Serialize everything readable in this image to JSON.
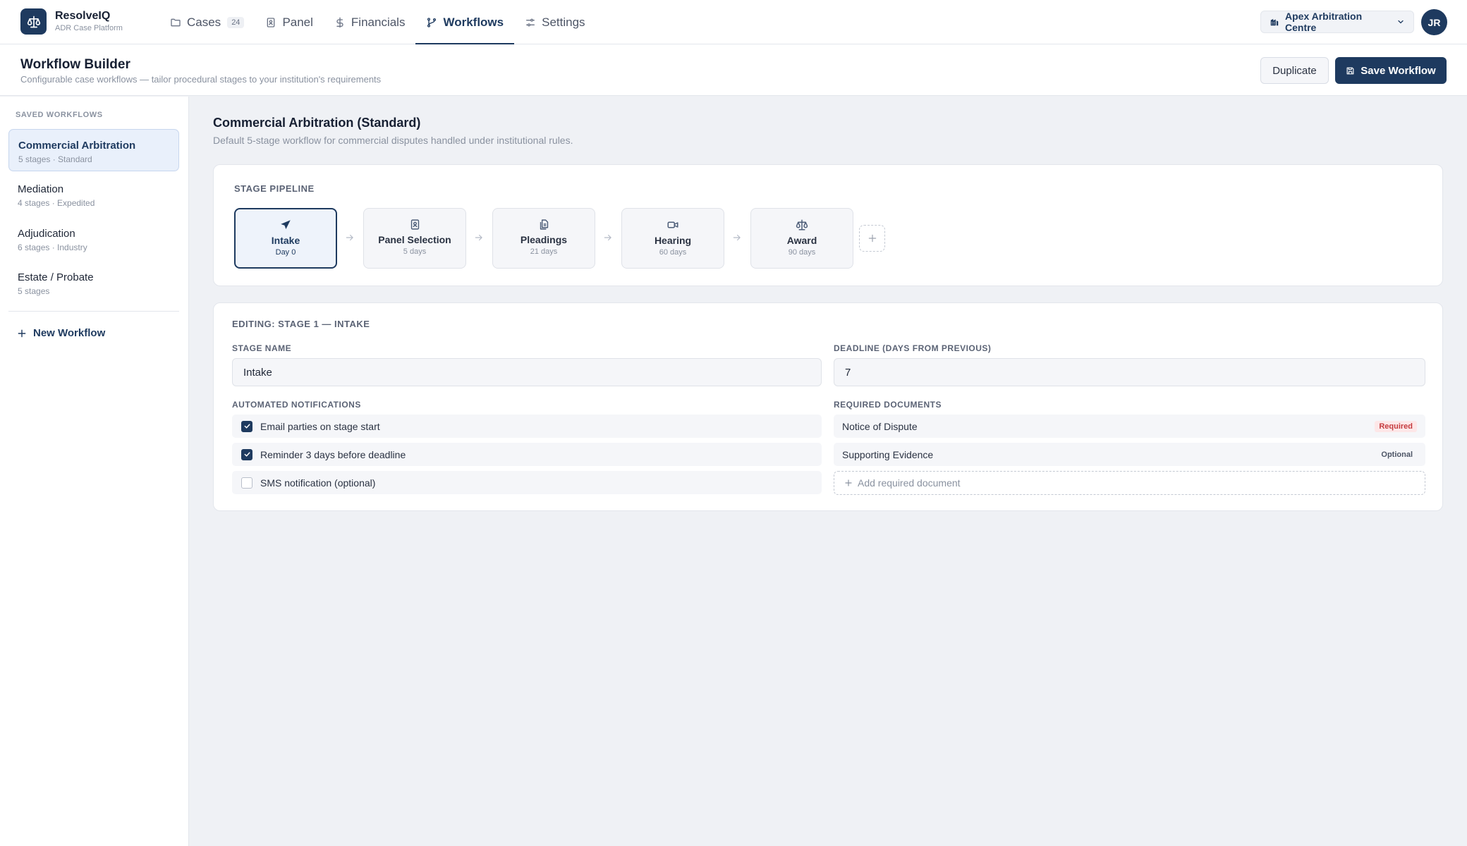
{
  "brand": {
    "name": "ResolveIQ",
    "subtitle": "ADR Case Platform"
  },
  "nav": {
    "tabs": [
      {
        "label": "Cases",
        "icon": "folder-icon",
        "count": "24"
      },
      {
        "label": "Panel",
        "icon": "id-badge-icon"
      },
      {
        "label": "Financials",
        "icon": "dollar-icon"
      },
      {
        "label": "Workflows",
        "icon": "branch-icon",
        "active": true
      },
      {
        "label": "Settings",
        "icon": "sliders-icon"
      }
    ],
    "org": {
      "label": "Apex Arbitration Centre",
      "icon": "building-icon"
    },
    "avatar": "JR"
  },
  "header": {
    "title": "Workflow Builder",
    "subtitle": "Configurable case workflows — tailor procedural stages to your institution's requirements",
    "duplicate_label": "Duplicate",
    "save_label": "Save Workflow"
  },
  "sidebar": {
    "heading": "SAVED WORKFLOWS",
    "items": [
      {
        "name": "Commercial Arbitration",
        "meta": "5 stages · Standard",
        "active": true
      },
      {
        "name": "Mediation",
        "meta": "4 stages · Expedited"
      },
      {
        "name": "Adjudication",
        "meta": "6 stages · Industry"
      },
      {
        "name": "Estate / Probate",
        "meta": "5 stages"
      }
    ],
    "new_label": "New Workflow"
  },
  "workflow": {
    "title": "Commercial Arbitration (Standard)",
    "description": "Default 5-stage workflow for commercial disputes handled under institutional rules."
  },
  "pipeline": {
    "label": "STAGE PIPELINE",
    "stages": [
      {
        "name": "Intake",
        "days": "Day 0",
        "icon": "send-icon",
        "active": true
      },
      {
        "name": "Panel Selection",
        "days": "5 days",
        "icon": "id-badge-icon"
      },
      {
        "name": "Pleadings",
        "days": "21 days",
        "icon": "documents-icon"
      },
      {
        "name": "Hearing",
        "days": "60 days",
        "icon": "video-icon"
      },
      {
        "name": "Award",
        "days": "90 days",
        "icon": "scales-icon"
      }
    ]
  },
  "editor": {
    "heading": "EDITING: STAGE 1 — INTAKE",
    "stage_name_label": "STAGE NAME",
    "stage_name_value": "Intake",
    "deadline_label": "DEADLINE (DAYS FROM PREVIOUS)",
    "deadline_value": "7",
    "notifications_label": "AUTOMATED NOTIFICATIONS",
    "notifications": [
      {
        "label": "Email parties on stage start",
        "checked": true
      },
      {
        "label": "Reminder 3 days before deadline",
        "checked": true
      },
      {
        "label": "SMS notification (optional)",
        "checked": false
      }
    ],
    "documents_label": "REQUIRED DOCUMENTS",
    "documents": [
      {
        "name": "Notice of Dispute",
        "badge": "Required"
      },
      {
        "name": "Supporting Evidence",
        "badge": "Optional"
      }
    ],
    "add_document_label": "Add required document"
  },
  "colors": {
    "primary": "#1e3a5f",
    "required": "#c53b3f",
    "background": "#eff1f5"
  }
}
